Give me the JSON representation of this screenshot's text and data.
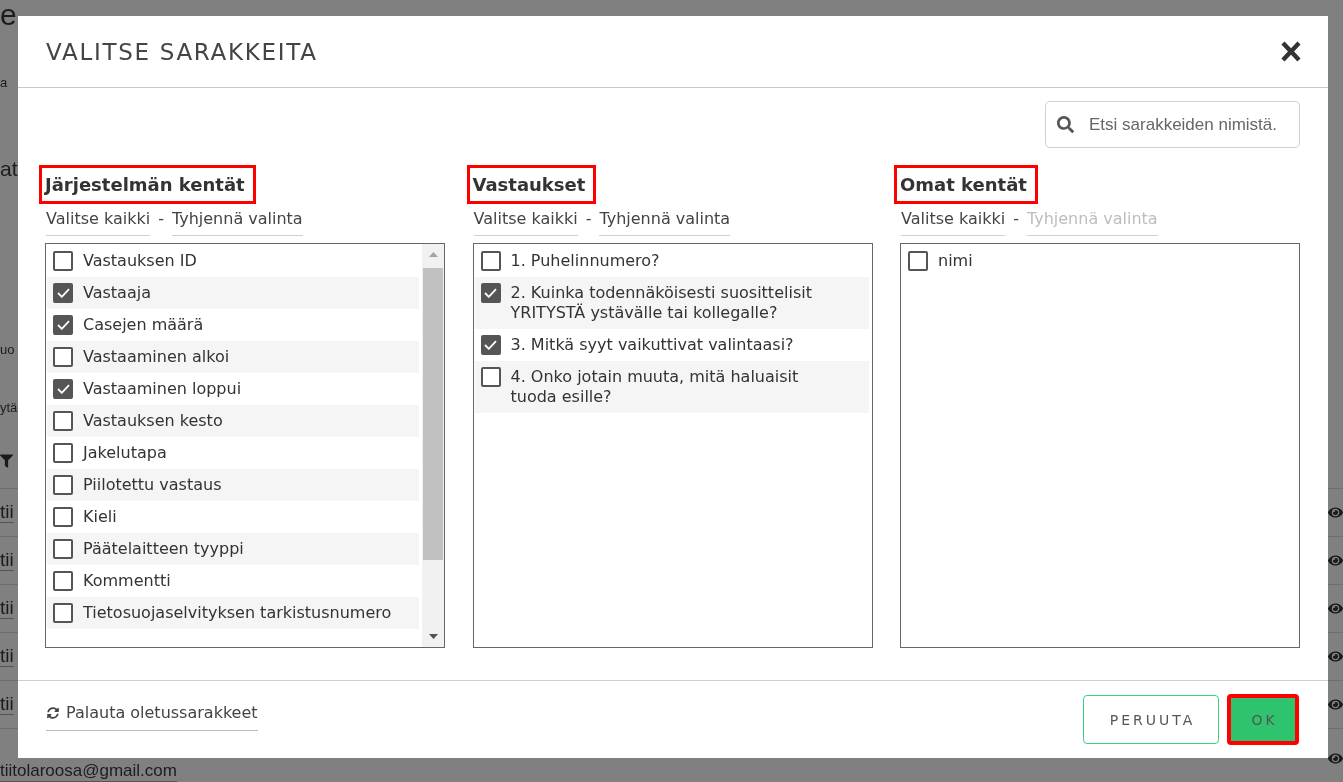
{
  "background": {
    "brand": "e",
    "fragments": [
      {
        "text": "a",
        "kind": "text"
      },
      {
        "text": "at",
        "kind": "heading"
      },
      {
        "text": "uo",
        "kind": "text"
      },
      {
        "text": "ytä",
        "kind": "text"
      }
    ],
    "rows": [
      {
        "text": "tii"
      },
      {
        "text": "tii"
      },
      {
        "text": "tii"
      },
      {
        "text": "tii"
      },
      {
        "text": "tii"
      },
      {
        "text": "tiitolaroosa@gmail.com"
      }
    ]
  },
  "dialog": {
    "title": "VALITSE SARAKKEITA",
    "search": {
      "placeholder": "Etsi sarakkeiden nimistä."
    },
    "columns": [
      {
        "title": "Järjestelmän kentät",
        "highlighted": true,
        "separator": "-",
        "actions": [
          {
            "label": "Valitse kaikki",
            "disabled": false
          },
          {
            "label": "Tyhjennä valinta",
            "disabled": false
          }
        ],
        "items": [
          {
            "label": "Vastauksen ID",
            "checked": false
          },
          {
            "label": "Vastaaja",
            "checked": true
          },
          {
            "label": "Casejen määrä",
            "checked": true
          },
          {
            "label": "Vastaaminen alkoi",
            "checked": false
          },
          {
            "label": "Vastaaminen loppui",
            "checked": true
          },
          {
            "label": "Vastauksen kesto",
            "checked": false
          },
          {
            "label": "Jakelutapa",
            "checked": false
          },
          {
            "label": "Piilotettu vastaus",
            "checked": false
          },
          {
            "label": "Kieli",
            "checked": false
          },
          {
            "label": "Päätelaitteen tyyppi",
            "checked": false
          },
          {
            "label": "Kommentti",
            "checked": false
          },
          {
            "label": "Tietosuojaselvityksen tarkistusnumero",
            "checked": false
          }
        ]
      },
      {
        "title": "Vastaukset",
        "highlighted": true,
        "separator": "-",
        "actions": [
          {
            "label": "Valitse kaikki",
            "disabled": false
          },
          {
            "label": "Tyhjennä valinta",
            "disabled": false
          }
        ],
        "items": [
          {
            "label": "1. Puhelinnumero?",
            "checked": false
          },
          {
            "label": "2. Kuinka todennäköisesti suosittelisit YRITYSTÄ ystävälle tai kollegalle?",
            "checked": true
          },
          {
            "label": "3. Mitkä syyt vaikuttivat valintaasi?",
            "checked": true
          },
          {
            "label": "4. Onko jotain muuta, mitä haluaisit tuoda esille?",
            "checked": false
          }
        ]
      },
      {
        "title": "Omat kentät",
        "highlighted": true,
        "separator": "-",
        "actions": [
          {
            "label": "Valitse kaikki",
            "disabled": false
          },
          {
            "label": "Tyhjennä valinta",
            "disabled": true
          }
        ],
        "items": [
          {
            "label": "nimi",
            "checked": false
          }
        ]
      }
    ],
    "reset_link": "Palauta oletussarakkeet",
    "buttons": [
      {
        "label": "PERUUTA",
        "kind": "secondary",
        "highlighted": false
      },
      {
        "label": "OK",
        "kind": "primary",
        "highlighted": true
      }
    ]
  }
}
